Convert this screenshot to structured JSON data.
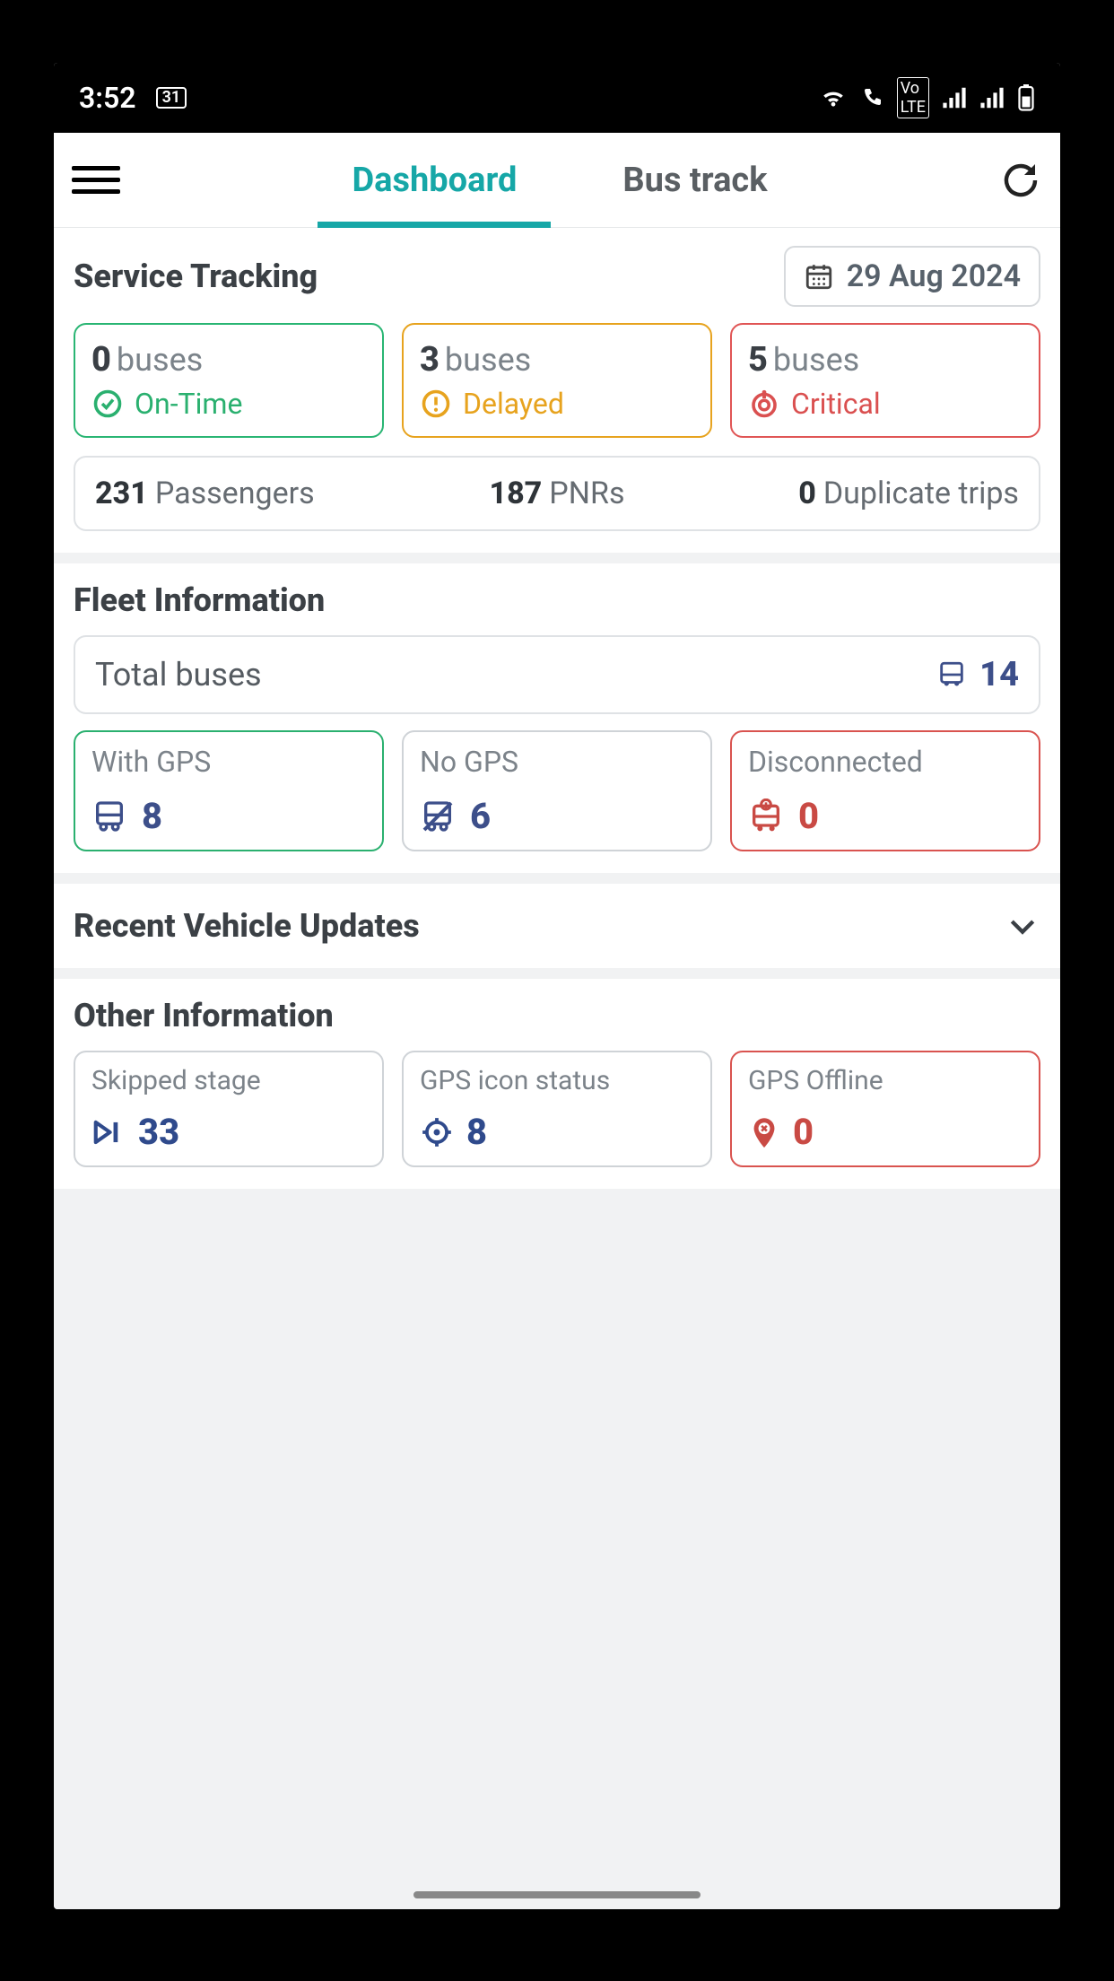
{
  "statusbar": {
    "time": "3:52",
    "date_badge": "31"
  },
  "header": {
    "tabs": [
      {
        "label": "Dashboard",
        "active": true
      },
      {
        "label": "Bus track",
        "active": false
      }
    ]
  },
  "service_tracking": {
    "title": "Service Tracking",
    "date": "29 Aug 2024",
    "cards": [
      {
        "count": "0",
        "unit": "buses",
        "status": "On-Time"
      },
      {
        "count": "3",
        "unit": "buses",
        "status": "Delayed"
      },
      {
        "count": "5",
        "unit": "buses",
        "status": "Critical"
      }
    ],
    "stats": [
      {
        "value": "231",
        "label": "Passengers"
      },
      {
        "value": "187",
        "label": "PNRs"
      },
      {
        "value": "0",
        "label": "Duplicate trips"
      }
    ]
  },
  "fleet": {
    "title": "Fleet Information",
    "total_label": "Total buses",
    "total_value": "14",
    "cards": [
      {
        "label": "With GPS",
        "value": "8"
      },
      {
        "label": "No GPS",
        "value": "6"
      },
      {
        "label": "Disconnected",
        "value": "0"
      }
    ]
  },
  "recent_updates": {
    "title": "Recent Vehicle Updates"
  },
  "other": {
    "title": "Other Information",
    "cards": [
      {
        "label": "Skipped stage",
        "value": "33"
      },
      {
        "label": "GPS icon status",
        "value": "8"
      },
      {
        "label": "GPS Offline",
        "value": "0"
      }
    ]
  }
}
